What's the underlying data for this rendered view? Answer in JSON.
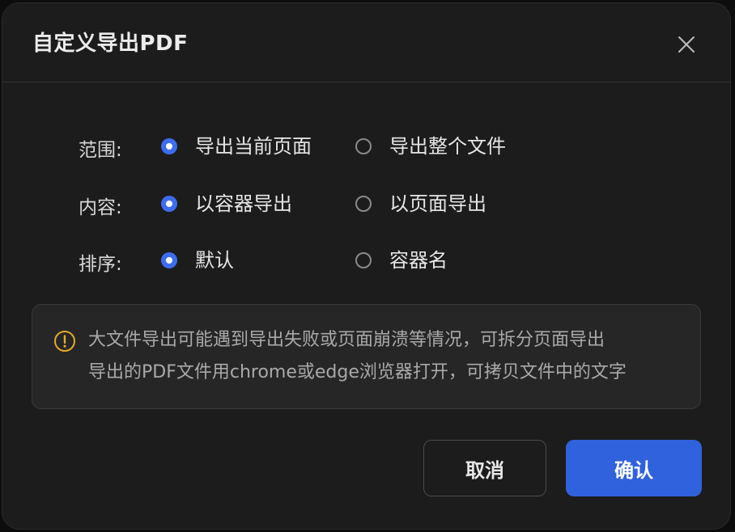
{
  "dialog": {
    "title": "自定义导出PDF",
    "close_icon": "close-icon"
  },
  "options": {
    "range": {
      "label": "范围:",
      "choices": [
        {
          "label": "导出当前页面",
          "checked": true
        },
        {
          "label": "导出整个文件",
          "checked": false
        }
      ]
    },
    "content": {
      "label": "内容:",
      "choices": [
        {
          "label": "以容器导出",
          "checked": true
        },
        {
          "label": "以页面导出",
          "checked": false
        }
      ]
    },
    "sort": {
      "label": "排序:",
      "choices": [
        {
          "label": "默认",
          "checked": true
        },
        {
          "label": "容器名",
          "checked": false
        }
      ]
    }
  },
  "notice": {
    "icon": "warning-icon",
    "line1": "大文件导出可能遇到导出失败或页面崩溃等情况，可拆分页面导出",
    "line2": "导出的PDF文件用chrome或edge浏览器打开，可拷贝文件中的文字"
  },
  "buttons": {
    "cancel": "取消",
    "confirm": "确认"
  },
  "colors": {
    "accent": "#3d6cf0",
    "confirm_bg": "#2f62dc",
    "warning": "#e3a92a",
    "dialog_bg": "#1c1c1c"
  }
}
